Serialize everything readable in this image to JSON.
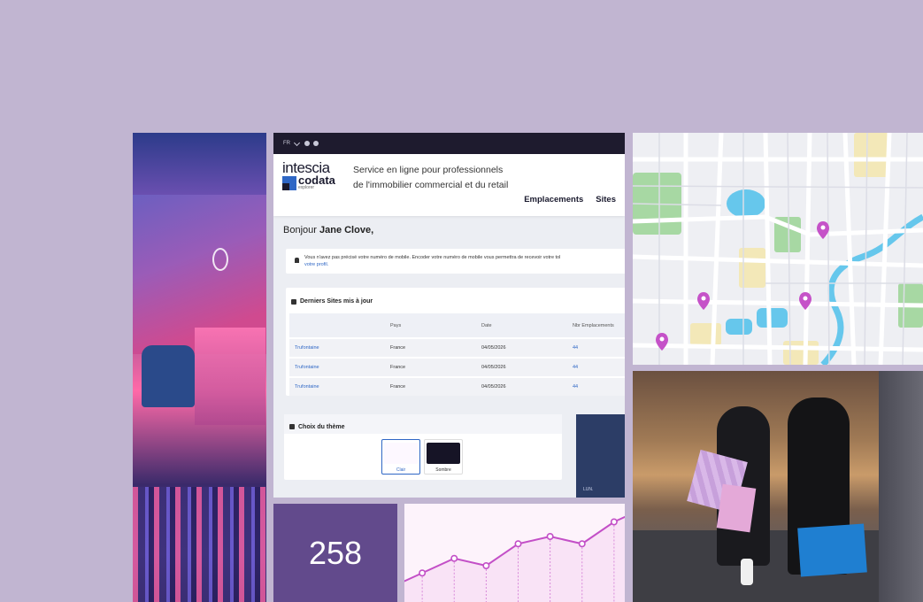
{
  "topbar": {
    "lang": "FR"
  },
  "brand": {
    "intescia": "intescia",
    "codata": "codata",
    "explorer": "explorer"
  },
  "header": {
    "tagline_line1": "Service en ligne pour professionnels",
    "tagline_line2": "de l'immobilier commercial et du retail",
    "nav": [
      "Emplacements",
      "Sites"
    ]
  },
  "greeting": {
    "prefix": "Bonjour",
    "name": "Jane Clove,"
  },
  "notice": {
    "text": "Vous n'avez pas précisé votre numéro de mobile. Encoder votre numéro de mobile vous permettra de recevoir votre tol",
    "link": "votre profil."
  },
  "sites": {
    "title": "Derniers Sites mis à jour",
    "columns": [
      "",
      "Pays",
      "Date",
      "Nbr Emplacements"
    ],
    "rows": [
      [
        "Trufontaine",
        "France",
        "04/05/2026",
        "44"
      ],
      [
        "Trufontaine",
        "France",
        "04/05/2026",
        "44"
      ],
      [
        "Trufontaine",
        "France",
        "04/05/2026",
        "44"
      ]
    ]
  },
  "theme": {
    "title": "Choix du thème",
    "options": [
      {
        "label": "Clair",
        "color": "#fdf8ff",
        "selected": true
      },
      {
        "label": "Sombre",
        "color": "#161426",
        "selected": false
      }
    ]
  },
  "side_panel": {
    "label": "LUN."
  },
  "stat": {
    "value": "258"
  },
  "chart_data": {
    "type": "line",
    "x": [
      0,
      1,
      2,
      3,
      4,
      5,
      6,
      7,
      8
    ],
    "values": [
      1,
      3,
      5,
      4,
      7,
      8,
      7,
      10,
      12
    ],
    "color": "#c34fc7",
    "fill": "#f7dcf3"
  },
  "map": {
    "pins": [
      "map-pin",
      "map-pin",
      "map-pin",
      "map-pin"
    ],
    "colors": {
      "water": "#66c7ec",
      "park": "#a7d8a3",
      "sand": "#f3e8b8",
      "road": "#ffffff",
      "pin": "#c552c8"
    }
  },
  "colors": {
    "background": "#c1b5d1",
    "accent": "#2f67c5",
    "stat_bg": "#624a8c"
  }
}
